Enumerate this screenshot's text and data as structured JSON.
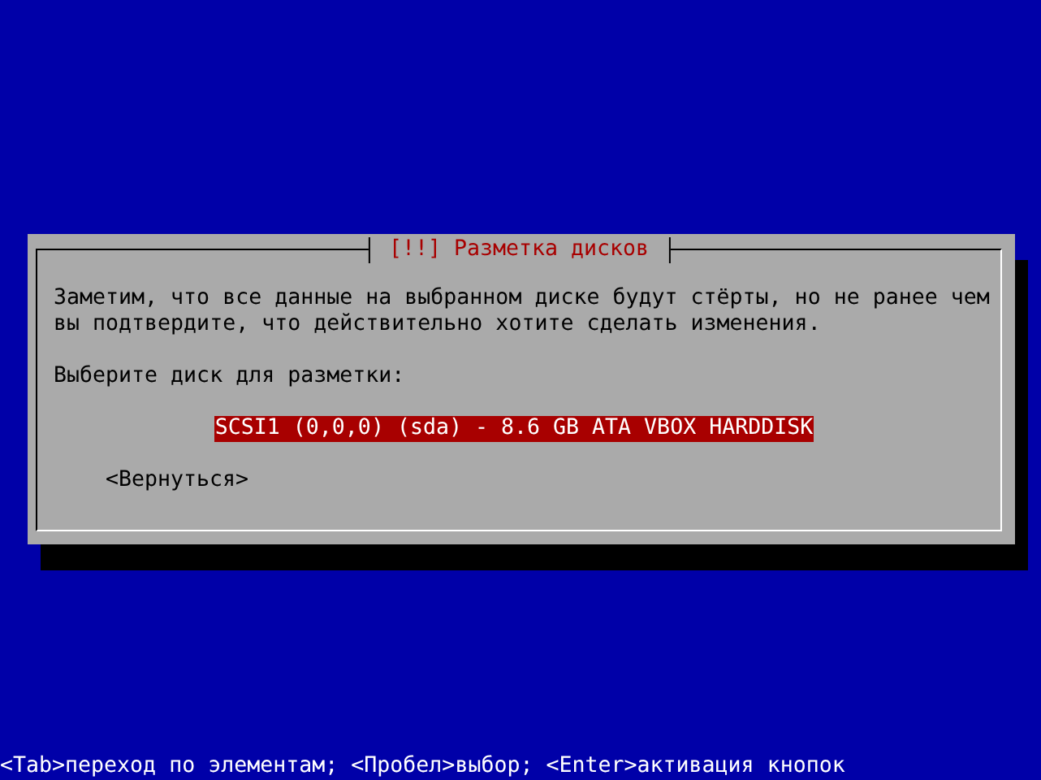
{
  "dialog": {
    "title": "[!!] Разметка дисков",
    "message": "Заметим, что все данные на выбранном диске будут стёрты, но не ранее чем вы подтвердите, что действительно хотите сделать изменения.",
    "prompt": "Выберите диск для разметки:",
    "disks": [
      {
        "label": "SCSI1 (0,0,0) (sda) - 8.6 GB ATA VBOX HARDDISK",
        "selected": true
      }
    ],
    "back_button": "<Вернуться>"
  },
  "status_bar": "<Tab>переход по элементам; <Пробел>выбор; <Enter>активация кнопок"
}
